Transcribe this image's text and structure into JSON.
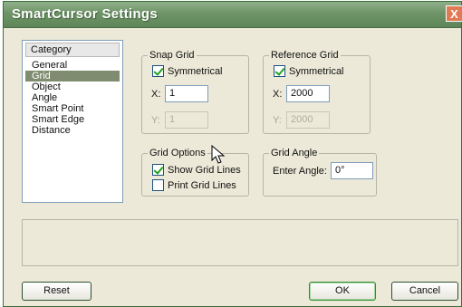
{
  "window": {
    "title": "SmartCursor Settings",
    "close_glyph": "X"
  },
  "category": {
    "header": "Category",
    "items": [
      "General",
      "Grid",
      "Object",
      "Angle",
      "Smart Point",
      "Smart Edge",
      "Distance"
    ],
    "selected": "Grid"
  },
  "snap_grid": {
    "legend": "Snap Grid",
    "symmetrical_label": "Symmetrical",
    "symmetrical_checked": true,
    "x_label": "X:",
    "x_value": "1",
    "y_label": "Y:",
    "y_value": "1"
  },
  "reference_grid": {
    "legend": "Reference Grid",
    "symmetrical_label": "Symmetrical",
    "symmetrical_checked": true,
    "x_label": "X:",
    "x_value": "2000",
    "y_label": "Y:",
    "y_value": "2000"
  },
  "grid_options": {
    "legend": "Grid Options",
    "show_label": "Show Grid Lines",
    "show_checked": true,
    "print_label": "Print Grid Lines",
    "print_checked": false
  },
  "grid_angle": {
    "legend": "Grid Angle",
    "angle_label": "Enter Angle:",
    "angle_value": "0°"
  },
  "buttons": {
    "reset": "Reset",
    "ok": "OK",
    "cancel": "Cancel"
  },
  "icons": {
    "cursor": "mouse-pointer-icon",
    "close": "close-icon",
    "check": "checkmark-icon"
  },
  "colors": {
    "titlebar": "#6f9468",
    "selection": "#808c70",
    "dialog_bg": "#ece9d8",
    "close_button": "#e07a55"
  }
}
